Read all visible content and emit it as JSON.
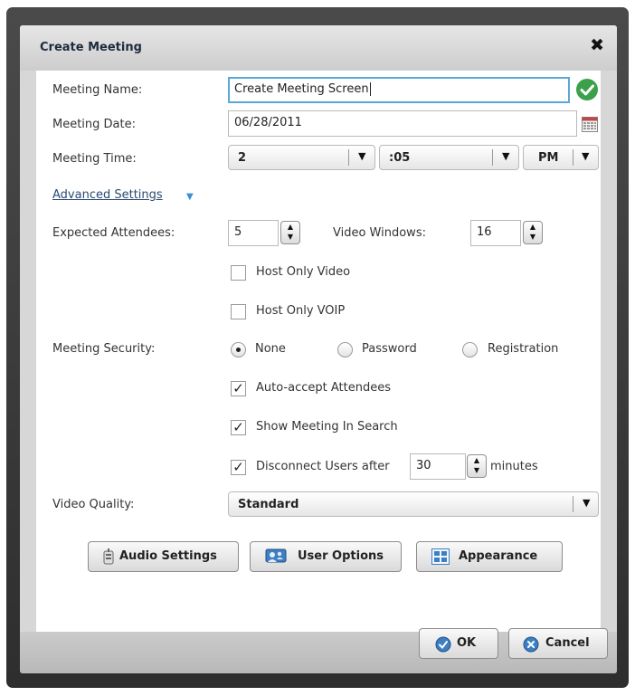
{
  "dialog": {
    "title": "Create Meeting",
    "close_glyph": "✖"
  },
  "form": {
    "meeting_name_label": "Meeting Name:",
    "meeting_name_value": "Create Meeting Screen",
    "meeting_date_label": "Meeting Date:",
    "meeting_date_value": "06/28/2011",
    "meeting_time_label": "Meeting Time:",
    "hour_value": "2",
    "minute_value": ":05",
    "ampm_value": "PM",
    "advanced_settings_link": "Advanced Settings",
    "expected_attendees_label": "Expected Attendees:",
    "expected_attendees_value": "5",
    "video_windows_label": "Video Windows:",
    "video_windows_value": "16",
    "host_only_video_label": "Host Only Video",
    "host_only_video_checked": false,
    "host_only_voip_label": "Host Only VOIP",
    "host_only_voip_checked": false,
    "meeting_security_label": "Meeting Security:",
    "security_options": [
      "None",
      "Password",
      "Registration"
    ],
    "security_selected": "None",
    "auto_accept_label": "Auto-accept Attendees",
    "auto_accept_checked": true,
    "show_in_search_label": "Show Meeting In Search",
    "show_in_search_checked": true,
    "disconnect_label": "Disconnect Users after",
    "disconnect_checked": true,
    "disconnect_minutes_value": "30",
    "minutes_label": "minutes",
    "video_quality_label": "Video Quality:",
    "video_quality_value": "Standard"
  },
  "actions": {
    "audio_settings": "Audio Settings",
    "user_options": "User Options",
    "appearance": "Appearance",
    "ok": "OK",
    "cancel": "Cancel"
  },
  "icons": {
    "validation": "checkmark-circle-icon",
    "calendar": "calendar-icon",
    "audio": "audio-device-icon",
    "user_options": "user-options-icon",
    "appearance": "appearance-icon",
    "ok": "ok-icon",
    "cancel": "cancel-icon"
  },
  "colors": {
    "valid_green": "#3aa04a",
    "focus_blue": "#5aa7d9",
    "link_blue": "#2a4a72",
    "button_icon_blue": "#3b7fc4"
  }
}
